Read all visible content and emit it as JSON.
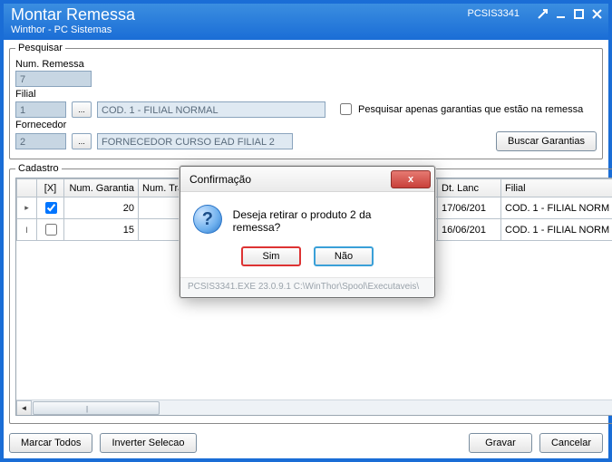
{
  "window": {
    "title": "Montar Remessa",
    "subtitle": "Winthor - PC Sistemas",
    "code": "PCSIS3341"
  },
  "search": {
    "legend": "Pesquisar",
    "remessa_label": "Num. Remessa",
    "remessa_value": "7",
    "filial_label": "Filial",
    "filial_code": "1",
    "filial_desc": "COD. 1 - FILIAL NORMAL",
    "chk_label": "Pesquisar apenas garantias que estão na remessa",
    "fornecedor_label": "Fornecedor",
    "fornecedor_code": "2",
    "fornecedor_desc": "FORNECEDOR CURSO EAD FILIAL 2",
    "buscar_btn": "Buscar Garantias",
    "ellipsis": "..."
  },
  "grid": {
    "legend": "Cadastro",
    "cols": {
      "sel": "",
      "x": "[X]",
      "garantia": "Num. Garantia",
      "trans": "Num. Trans",
      "date": "Dt. Lanc",
      "filial": "Filial"
    },
    "rows": [
      {
        "marker": "▸",
        "checked": true,
        "garantia": "20",
        "date": "17/06/201",
        "filial": "COD. 1 - FILIAL NORM"
      },
      {
        "marker": "I",
        "checked": false,
        "garantia": "15",
        "date": "16/06/201",
        "filial": "COD. 1 - FILIAL NORM"
      }
    ],
    "scroll_grip": "|||"
  },
  "footer": {
    "marcar": "Marcar Todos",
    "inverter": "Inverter Selecao",
    "gravar": "Gravar",
    "cancelar": "Cancelar"
  },
  "dialog": {
    "title": "Confirmação",
    "question_glyph": "?",
    "close_glyph": "x",
    "message": "Deseja retirar o produto 2 da remessa?",
    "sim": "Sim",
    "nao": "Não",
    "status": "PCSIS3341.EXE 23.0.9.1 C:\\WinThor\\Spool\\Executaveis\\"
  }
}
